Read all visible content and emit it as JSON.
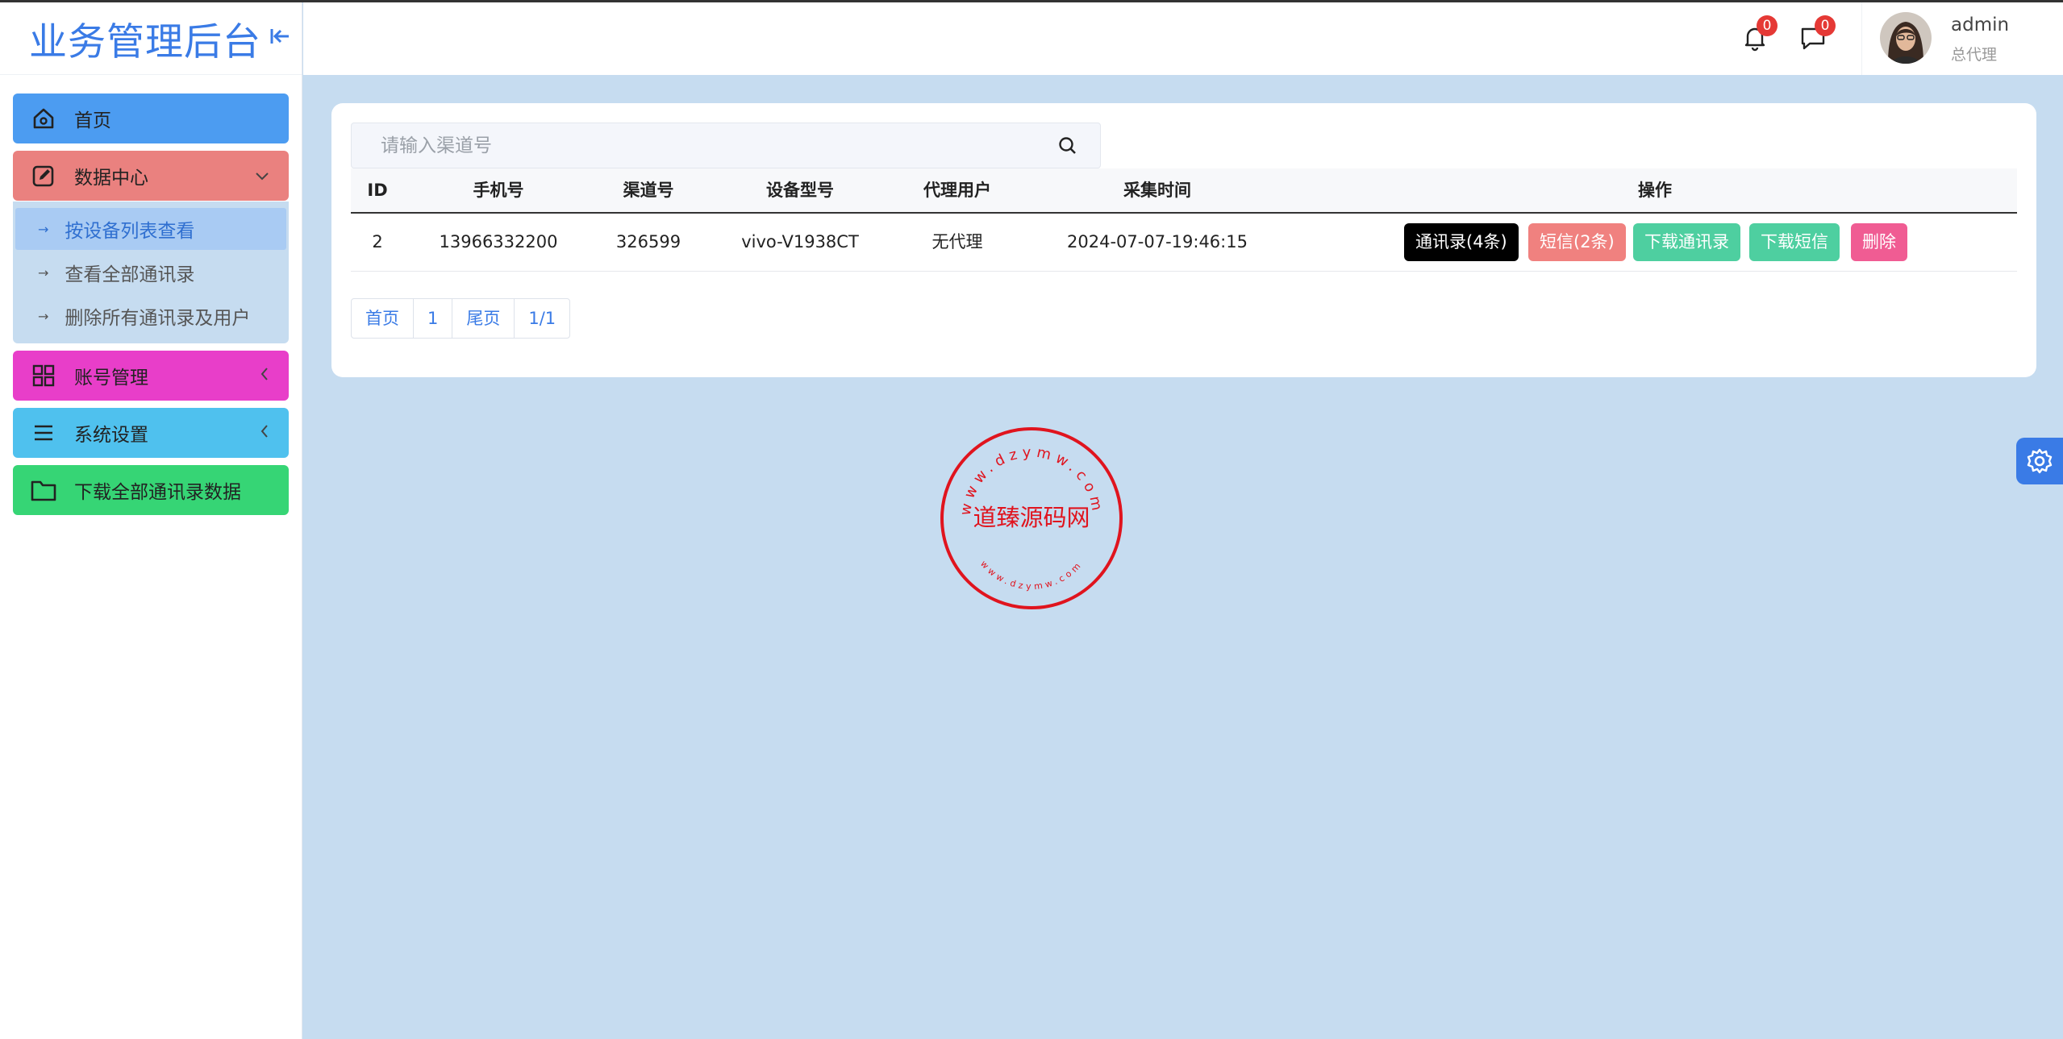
{
  "brand": {
    "title": "业务管理后台",
    "collapse_icon": "collapse-left-icon"
  },
  "sidebar": {
    "items": [
      {
        "label": "首页",
        "icon": "home-icon",
        "color": "#4c9cf1"
      },
      {
        "label": "数据中心",
        "icon": "edit-icon",
        "color": "#ea817f",
        "expanded": true,
        "children": [
          {
            "label": "按设备列表查看",
            "active": true
          },
          {
            "label": "查看全部通讯录",
            "active": false
          },
          {
            "label": "删除所有通讯录及用户",
            "active": false
          }
        ]
      },
      {
        "label": "账号管理",
        "icon": "grid-icon",
        "color": "#e83ec9"
      },
      {
        "label": "系统设置",
        "icon": "menu-icon",
        "color": "#4fc1ee"
      },
      {
        "label": "下载全部通讯录数据",
        "icon": "folder-icon",
        "color": "#36d575"
      }
    ]
  },
  "header": {
    "notifications": {
      "icon": "bell-icon",
      "count": "0"
    },
    "messages": {
      "icon": "chat-icon",
      "count": "0"
    },
    "user": {
      "name": "admin",
      "role": "总代理"
    }
  },
  "search": {
    "placeholder": "请输入渠道号",
    "value": ""
  },
  "table": {
    "columns": [
      "ID",
      "手机号",
      "渠道号",
      "设备型号",
      "代理用户",
      "采集时间",
      "操作"
    ],
    "rows": [
      {
        "id": "2",
        "phone": "13966332200",
        "channel": "326599",
        "device": "vivo-V1938CT",
        "agent": "无代理",
        "time": "2024-07-07-19:46:15",
        "actions": [
          "通讯录(4条)",
          "短信(2条)",
          "下载通讯录",
          "下载短信",
          "删除"
        ]
      }
    ]
  },
  "pagination": {
    "first": "首页",
    "page": "1",
    "last": "尾页",
    "info": "1/1"
  },
  "stamp": {
    "text": "道臻源码网",
    "ring_text": "www.dzymw.com",
    "color": "#e0141e"
  },
  "colors": {
    "accent": "#3a7be6",
    "background": "#c6dcf0",
    "badge": "#e53935"
  }
}
